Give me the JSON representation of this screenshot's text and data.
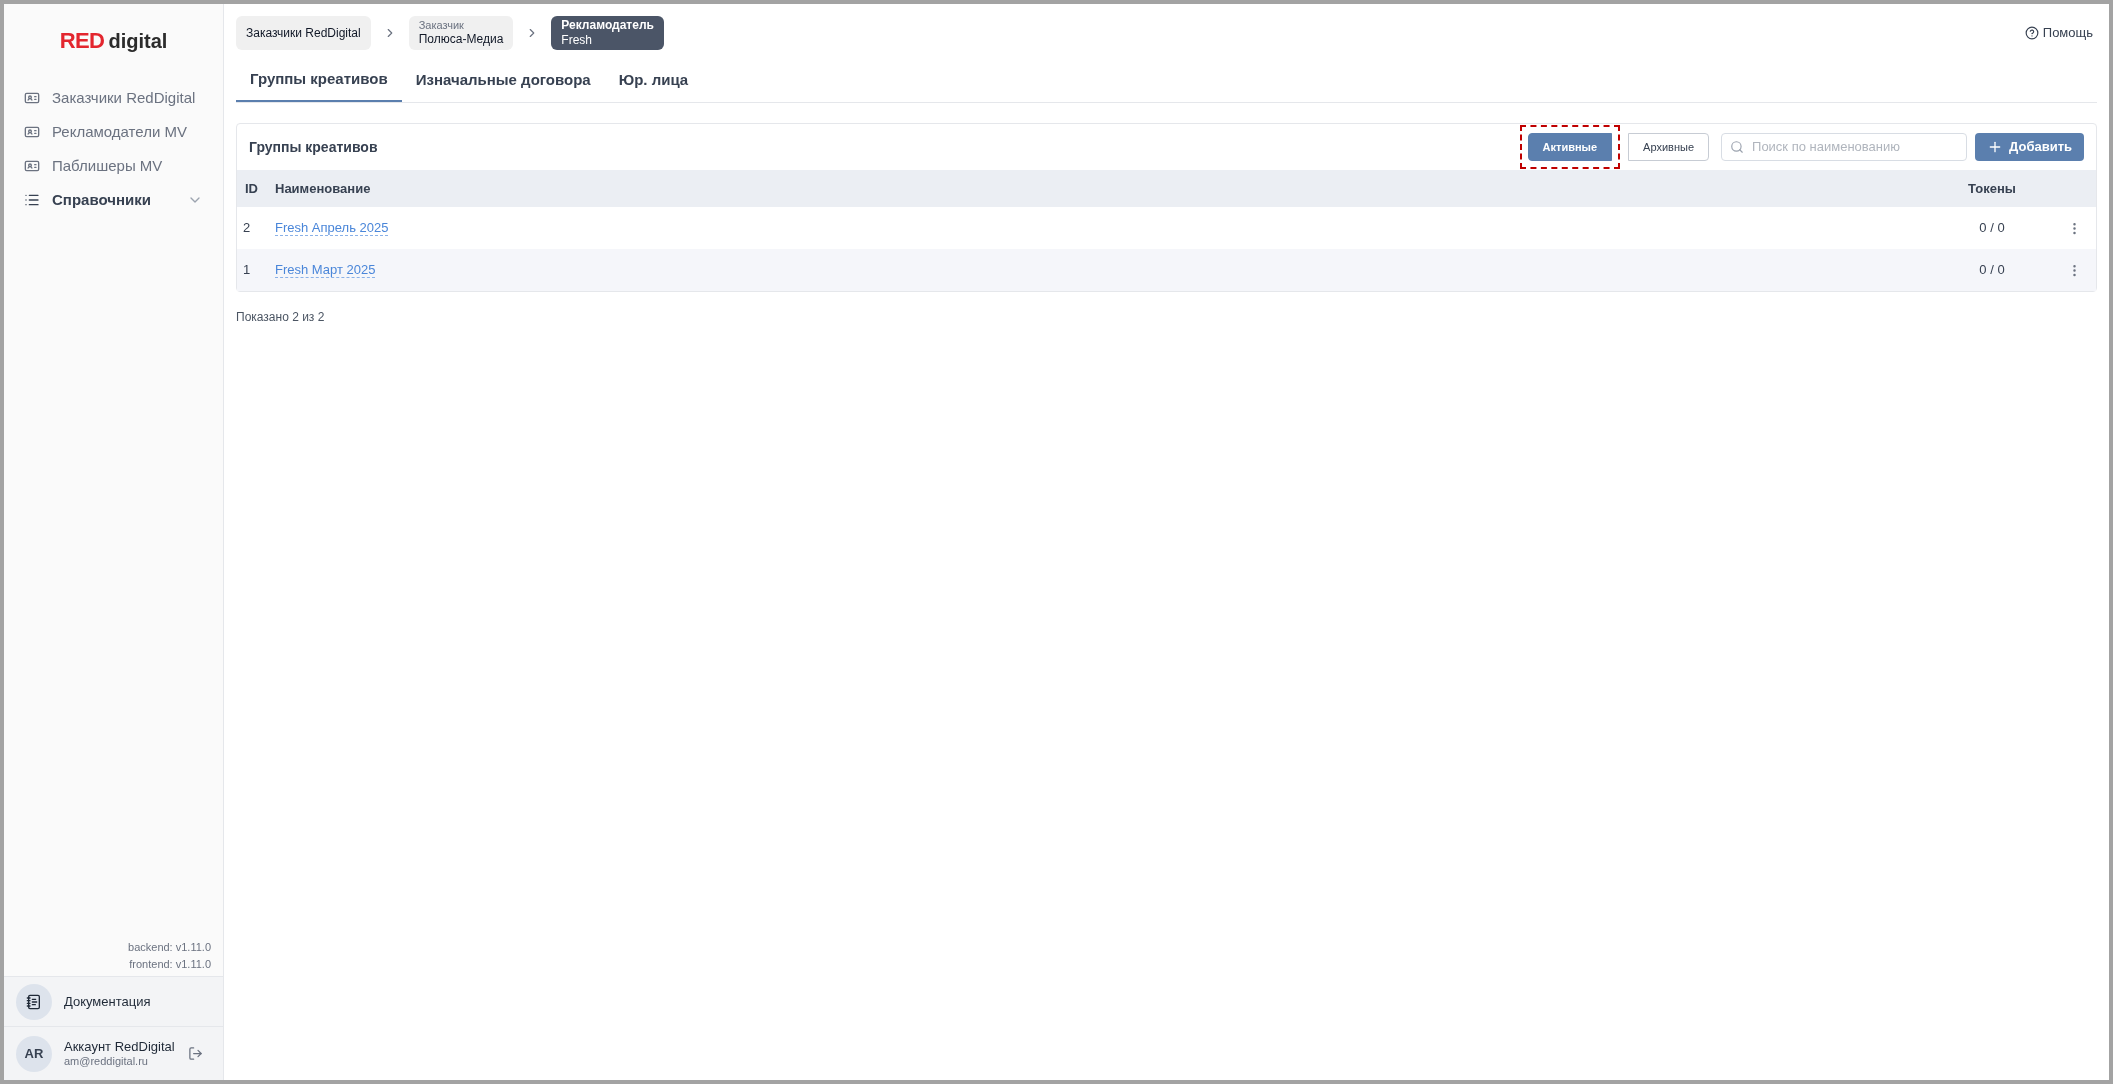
{
  "logo": {
    "brand": "RED",
    "suffix": "digital"
  },
  "sidebar": {
    "items": [
      {
        "label": "Заказчики RedDigital",
        "kind": "link",
        "selected": false
      },
      {
        "label": "Рекламодатели MV",
        "kind": "link",
        "selected": false
      },
      {
        "label": "Паблишеры MV",
        "kind": "link",
        "selected": false
      },
      {
        "label": "Справочники",
        "kind": "group",
        "expanded": false,
        "selected": false
      }
    ],
    "versions": [
      "backend: v1.11.0",
      "frontend: v1.11.0"
    ],
    "docs": "Документация",
    "account": {
      "initials": "AR",
      "name": "Аккаунт RedDigital",
      "email": "am@reddigital.ru"
    }
  },
  "breadcrumbs": [
    {
      "title": "Заказчики RedDigital",
      "selected": false
    },
    {
      "caption": "Заказчик",
      "title": "Полюса-Медиа",
      "selected": false
    },
    {
      "caption": "Рекламодатель",
      "title": "Fresh",
      "selected": true
    }
  ],
  "help": "Помощь",
  "tabs": [
    {
      "label": "Группы креативов",
      "selected": true
    },
    {
      "label": "Изначальные договора",
      "selected": false
    },
    {
      "label": "Юр. лица",
      "selected": false
    }
  ],
  "card": {
    "title": "Группы креативов",
    "filters": [
      {
        "label": "Активные",
        "selected": true,
        "highlighted": true
      },
      {
        "label": "Архивные",
        "selected": false,
        "highlighted": false
      }
    ],
    "search": {
      "placeholder": "Поиск по наименованию"
    },
    "add_button": "Добавить",
    "table": {
      "columns": [
        "ID",
        "Наименование",
        "Токены"
      ],
      "rows": [
        {
          "id": "2",
          "name": "Fresh Апрель 2025",
          "tokens": "0 / 0"
        },
        {
          "id": "1",
          "name": "Fresh Март 2025",
          "tokens": "0 / 0"
        }
      ]
    }
  },
  "footer": "Показано 2 из 2"
}
